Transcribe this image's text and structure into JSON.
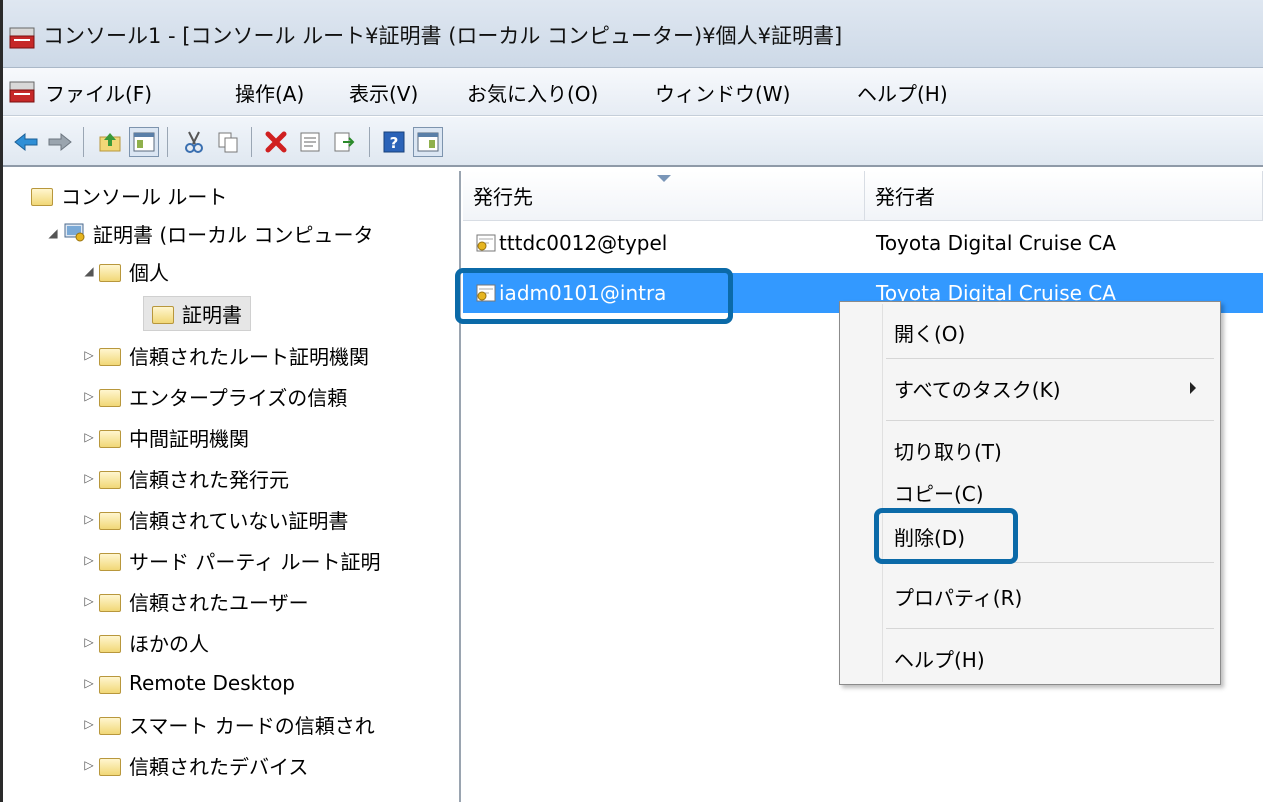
{
  "title_bar": {
    "title": "コンソール1 - [コンソール ルート¥証明書 (ローカル コンピューター)¥個人¥証明書]"
  },
  "menu": {
    "items": [
      {
        "label": "ファイル(F)"
      },
      {
        "label": "操作(A)"
      },
      {
        "label": "表示(V)"
      },
      {
        "label": "お気に入り(O)"
      },
      {
        "label": "ウィンドウ(W)"
      },
      {
        "label": "ヘルプ(H)"
      }
    ]
  },
  "toolbar": {
    "buttons": [
      "back-arrow-icon",
      "forward-arrow-icon",
      "up-folder-icon",
      "show-hide-tree-icon",
      "cut-icon",
      "copy-icon",
      "delete-icon",
      "properties-icon",
      "export-list-icon",
      "help-icon",
      "show-hide-action-pane-icon"
    ]
  },
  "tree": {
    "root": "コンソール ルート",
    "certs": "証明書 (ローカル コンピュータ",
    "personal": "個人",
    "personal_certs": "証明書",
    "folders": [
      "信頼されたルート証明機関",
      "エンタープライズの信頼",
      "中間証明機関",
      "信頼された発行元",
      "信頼されていない証明書",
      "サード パーティ ルート証明",
      "信頼されたユーザー",
      "ほかの人",
      "Remote Desktop",
      "スマート カードの信頼され",
      "信頼されたデバイス"
    ]
  },
  "list": {
    "columns": [
      "発行先",
      "発行者"
    ],
    "rows": [
      {
        "issued_to": "tttdc0012@typel",
        "issued_by": "Toyota Digital Cruise CA"
      },
      {
        "issued_to": "iadm0101@intra",
        "issued_by": "Toyota Digital Cruise CA"
      }
    ]
  },
  "context_menu": {
    "open": "開く(O)",
    "all_tasks": "すべてのタスク(K)",
    "cut": "切り取り(T)",
    "copy": "コピー(C)",
    "delete": "削除(D)",
    "properties": "プロパティ(R)",
    "help": "ヘルプ(H)"
  },
  "colors": {
    "selection": "#3399ff",
    "highlight": "#0b6aa8"
  }
}
